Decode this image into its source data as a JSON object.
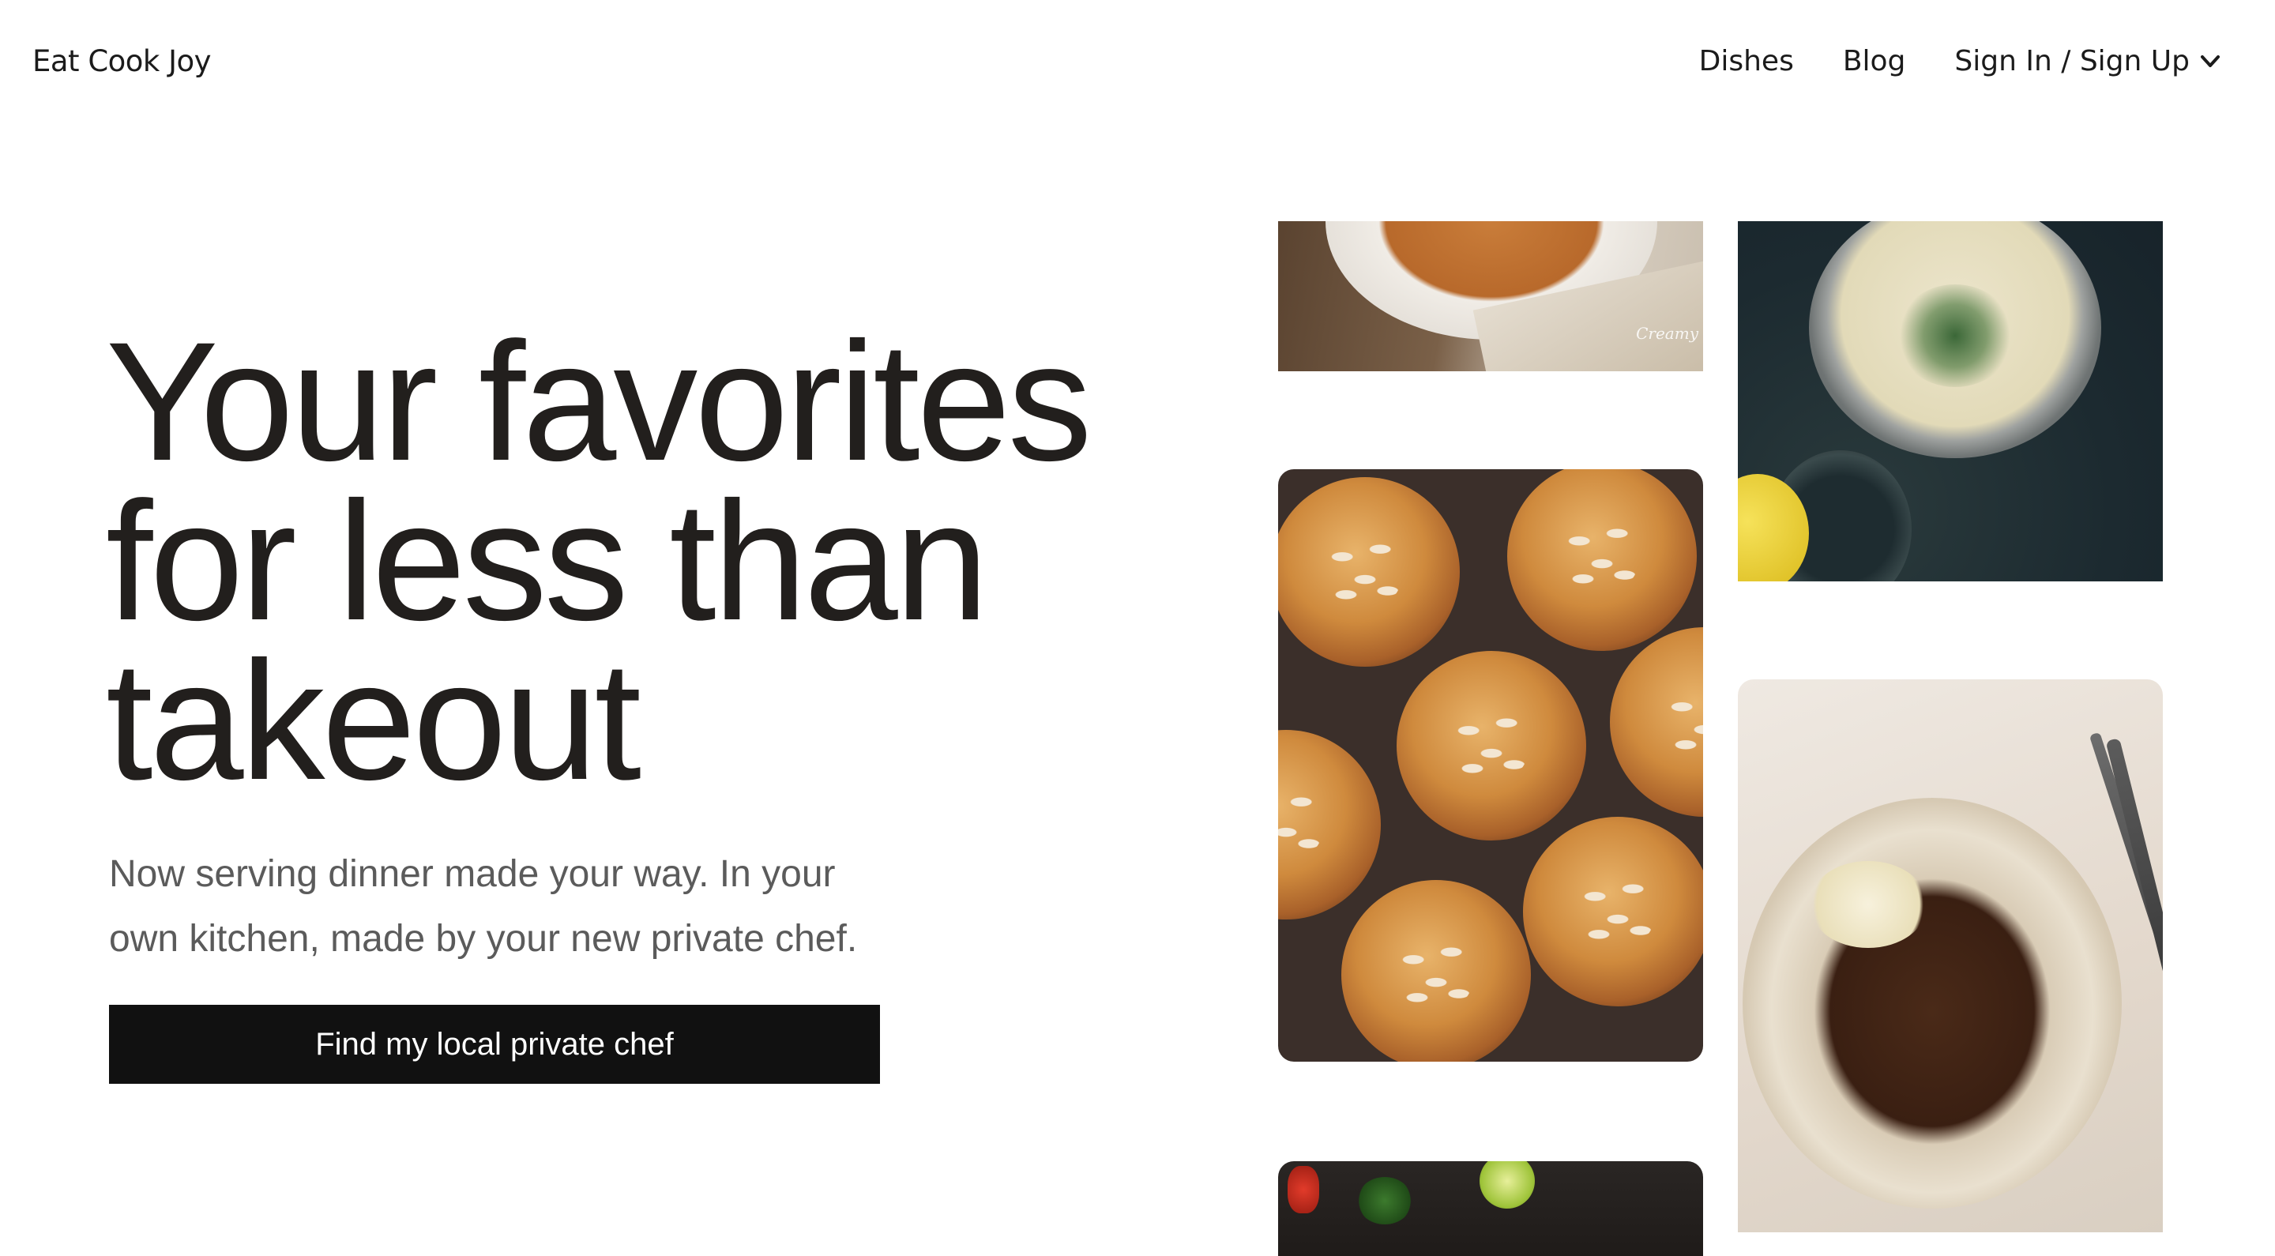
{
  "header": {
    "logo": "Eat Cook Joy",
    "nav": {
      "dishes": "Dishes",
      "blog": "Blog",
      "account": "Sign In / Sign Up"
    }
  },
  "hero": {
    "title": "Your favorites for less than takeout",
    "subtitle": "Now serving dinner made your way. In your own kitchen, made by your new private chef.",
    "cta_label": "Find my local private chef"
  },
  "photos": {
    "creamy_dish_watermark": "Creamy"
  },
  "colors": {
    "text_primary": "#221f1d",
    "text_secondary": "#5b5b5b",
    "button_bg": "#111111",
    "button_text": "#ffffff",
    "background": "#ffffff"
  },
  "icons": {
    "account_dropdown": "chevron-down-icon"
  }
}
